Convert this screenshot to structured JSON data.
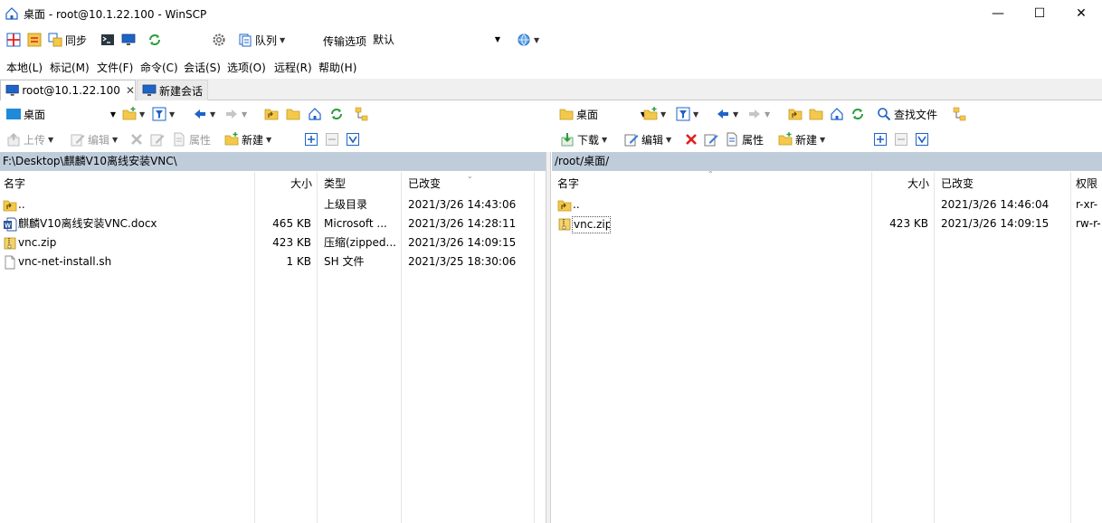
{
  "window": {
    "title": "桌面 - root@10.1.22.100 - WinSCP",
    "min": "—",
    "max": "☐",
    "close": "✕"
  },
  "toolbar": {
    "sync_label": "同步",
    "queue_label": "队列",
    "transfer_label": "传输选项",
    "transfer_value": "默认"
  },
  "menu": [
    "本地(L)",
    "标记(M)",
    "文件(F)",
    "命令(C)",
    "会话(S)",
    "选项(O)",
    "远程(R)",
    "帮助(H)"
  ],
  "tabs": [
    {
      "label": "root@10.1.22.100",
      "close": "✕"
    },
    {
      "label": "新建会话"
    }
  ],
  "left": {
    "location": "桌面",
    "upload": "上传",
    "edit": "编辑",
    "props": "属性",
    "new": "新建",
    "path": "F:\\Desktop\\麒麟V10离线安装VNC\\",
    "columns": {
      "name": "名字",
      "size": "大小",
      "type": "类型",
      "changed": "已改变"
    },
    "rows": [
      {
        "icon": "parent-folder-icon",
        "name": "..",
        "size": "",
        "type": "上级目录",
        "changed": "2021/3/26  14:43:06"
      },
      {
        "icon": "word-document-icon",
        "name": "麒麟V10离线安装VNC.docx",
        "size": "465 KB",
        "type": "Microsoft ...",
        "changed": "2021/3/26  14:28:11"
      },
      {
        "icon": "zip-file-icon",
        "name": "vnc.zip",
        "size": "423 KB",
        "type": "压缩(zipped...",
        "changed": "2021/3/26  14:09:15"
      },
      {
        "icon": "file-icon",
        "name": "vnc-net-install.sh",
        "size": "1 KB",
        "type": "SH 文件",
        "changed": "2021/3/25  18:30:06"
      }
    ]
  },
  "right": {
    "location": "桌面",
    "download": "下载",
    "edit": "编辑",
    "props": "属性",
    "new": "新建",
    "find": "查找文件",
    "path": "/root/桌面/",
    "columns": {
      "name": "名字",
      "size": "大小",
      "changed": "已改变",
      "rights": "权限"
    },
    "rows": [
      {
        "icon": "parent-folder-icon",
        "name": "..",
        "size": "",
        "changed": "2021/3/26 14:46:04",
        "rights": "r-xr-"
      },
      {
        "icon": "zip-file-icon",
        "name": "vnc.zip",
        "size": "423 KB",
        "changed": "2021/3/26 14:09:15",
        "rights": "rw-r-"
      }
    ]
  },
  "colors": {
    "path_bar": "#bfcddb",
    "accent_blue": "#1e64c8",
    "folder_yellow": "#f3c84b"
  }
}
